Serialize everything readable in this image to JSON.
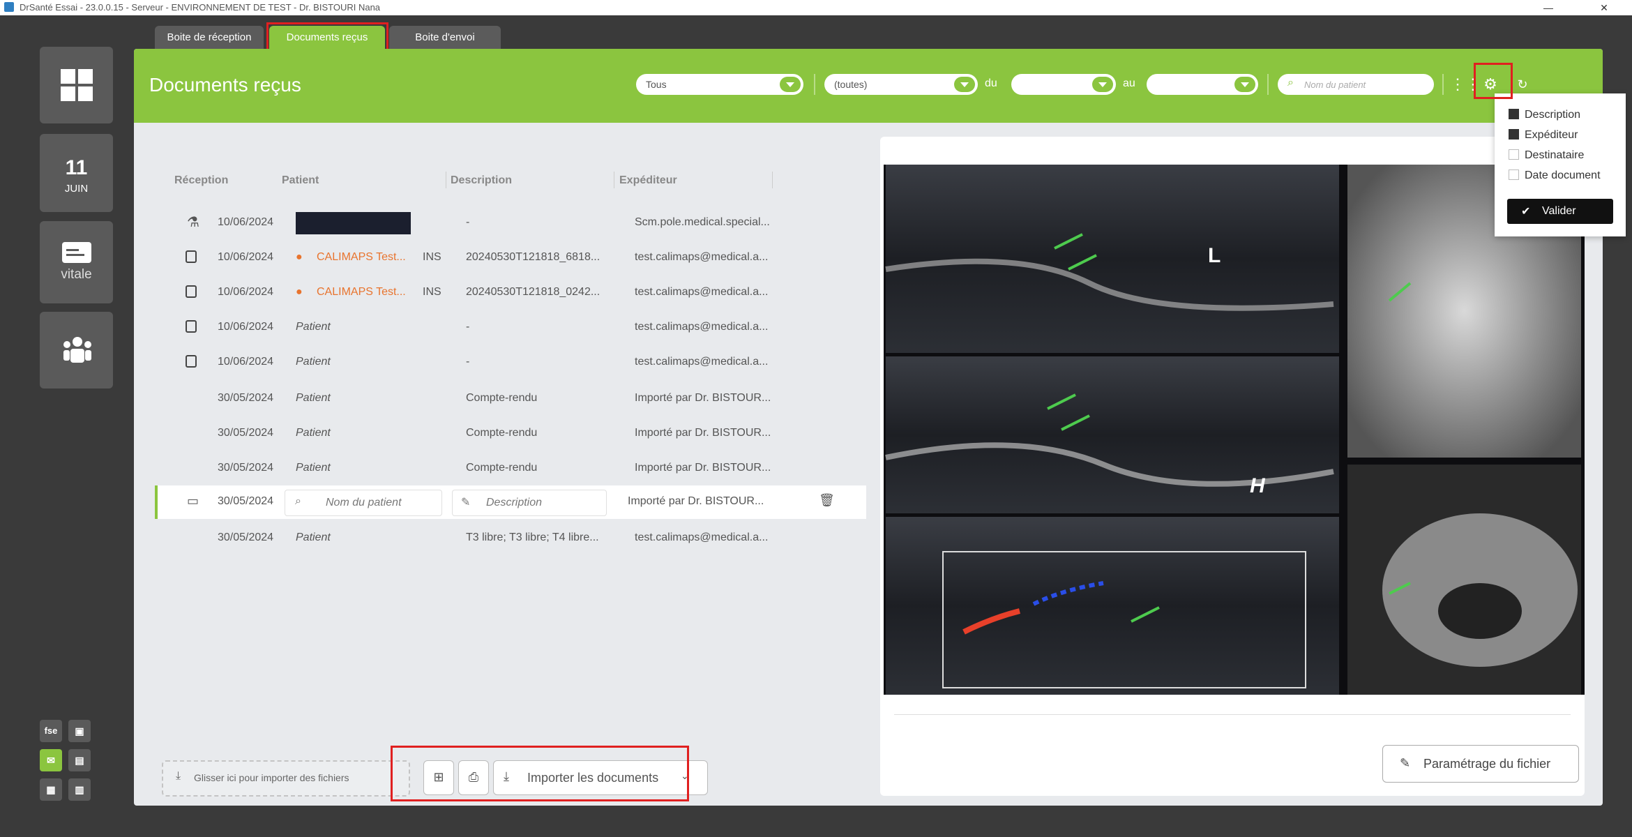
{
  "window": {
    "title": "DrSanté Essai - 23.0.0.15 - Serveur - ENVIRONNEMENT DE TEST - Dr. BISTOURI Nana",
    "minimize": "—",
    "close": "✕"
  },
  "rail": {
    "date_day": "11",
    "date_month": "JUIN",
    "vitale_label": "vitale",
    "fse_label": "fse"
  },
  "tabs": [
    {
      "label": "Boite de réception",
      "active": false
    },
    {
      "label": "Documents reçus",
      "active": true
    },
    {
      "label": "Boite d'envoi",
      "active": false
    }
  ],
  "header": {
    "title": "Documents reçus",
    "filter_type": "Tous",
    "filter_category": "(toutes)",
    "from_label": "du",
    "to_label": "au",
    "search_placeholder": "Nom du patient"
  },
  "columns": {
    "reception": "Réception",
    "patient": "Patient",
    "description": "Description",
    "sender": "Expéditeur"
  },
  "rows": [
    {
      "date": "10/06/2024",
      "patient": "",
      "description": "-",
      "sender": "Scm.pole.medical.special..."
    },
    {
      "date": "10/06/2024",
      "patient": "CALIMAPS Test...",
      "ins": "INS",
      "description": "20240530T121818_6818...",
      "sender": "test.calimaps@medical.a..."
    },
    {
      "date": "10/06/2024",
      "patient": "CALIMAPS Test...",
      "ins": "INS",
      "description": "20240530T121818_0242...",
      "sender": "test.calimaps@medical.a..."
    },
    {
      "date": "10/06/2024",
      "patient": "Patient",
      "description": "-",
      "sender": "test.calimaps@medical.a..."
    },
    {
      "date": "10/06/2024",
      "patient": "Patient",
      "description": "-",
      "sender": "test.calimaps@medical.a..."
    },
    {
      "date": "30/05/2024",
      "patient": "Patient",
      "description": "Compte-rendu",
      "sender": "Importé par Dr. BISTOUR..."
    },
    {
      "date": "30/05/2024",
      "patient": "Patient",
      "description": "Compte-rendu",
      "sender": "Importé par Dr. BISTOUR..."
    },
    {
      "date": "30/05/2024",
      "patient": "Patient",
      "description": "Compte-rendu",
      "sender": "Importé par Dr. BISTOUR..."
    },
    {
      "date": "30/05/2024",
      "patient_placeholder": "Nom du patient",
      "description_placeholder": "Description",
      "sender": "Importé par Dr. BISTOUR..."
    },
    {
      "date": "30/05/2024",
      "patient": "Patient",
      "description": "T3 libre; T3 libre; T4 libre...",
      "sender": "test.calimaps@medical.a..."
    }
  ],
  "bottom": {
    "dropzone": "Glisser ici pour importer des fichiers",
    "import_label": "Importer les documents"
  },
  "preview": {
    "label_L": "L",
    "label_H": "H",
    "settings_button": "Paramétrage du fichier"
  },
  "column_menu": {
    "items": [
      {
        "label": "Description",
        "checked": true
      },
      {
        "label": "Expéditeur",
        "checked": true
      },
      {
        "label": "Destinataire",
        "checked": false
      },
      {
        "label": "Date document",
        "checked": false
      }
    ],
    "validate": "Valider"
  },
  "colors": {
    "accent": "#8bc53f",
    "highlight": "#e02020",
    "patient": "#e8742e"
  }
}
